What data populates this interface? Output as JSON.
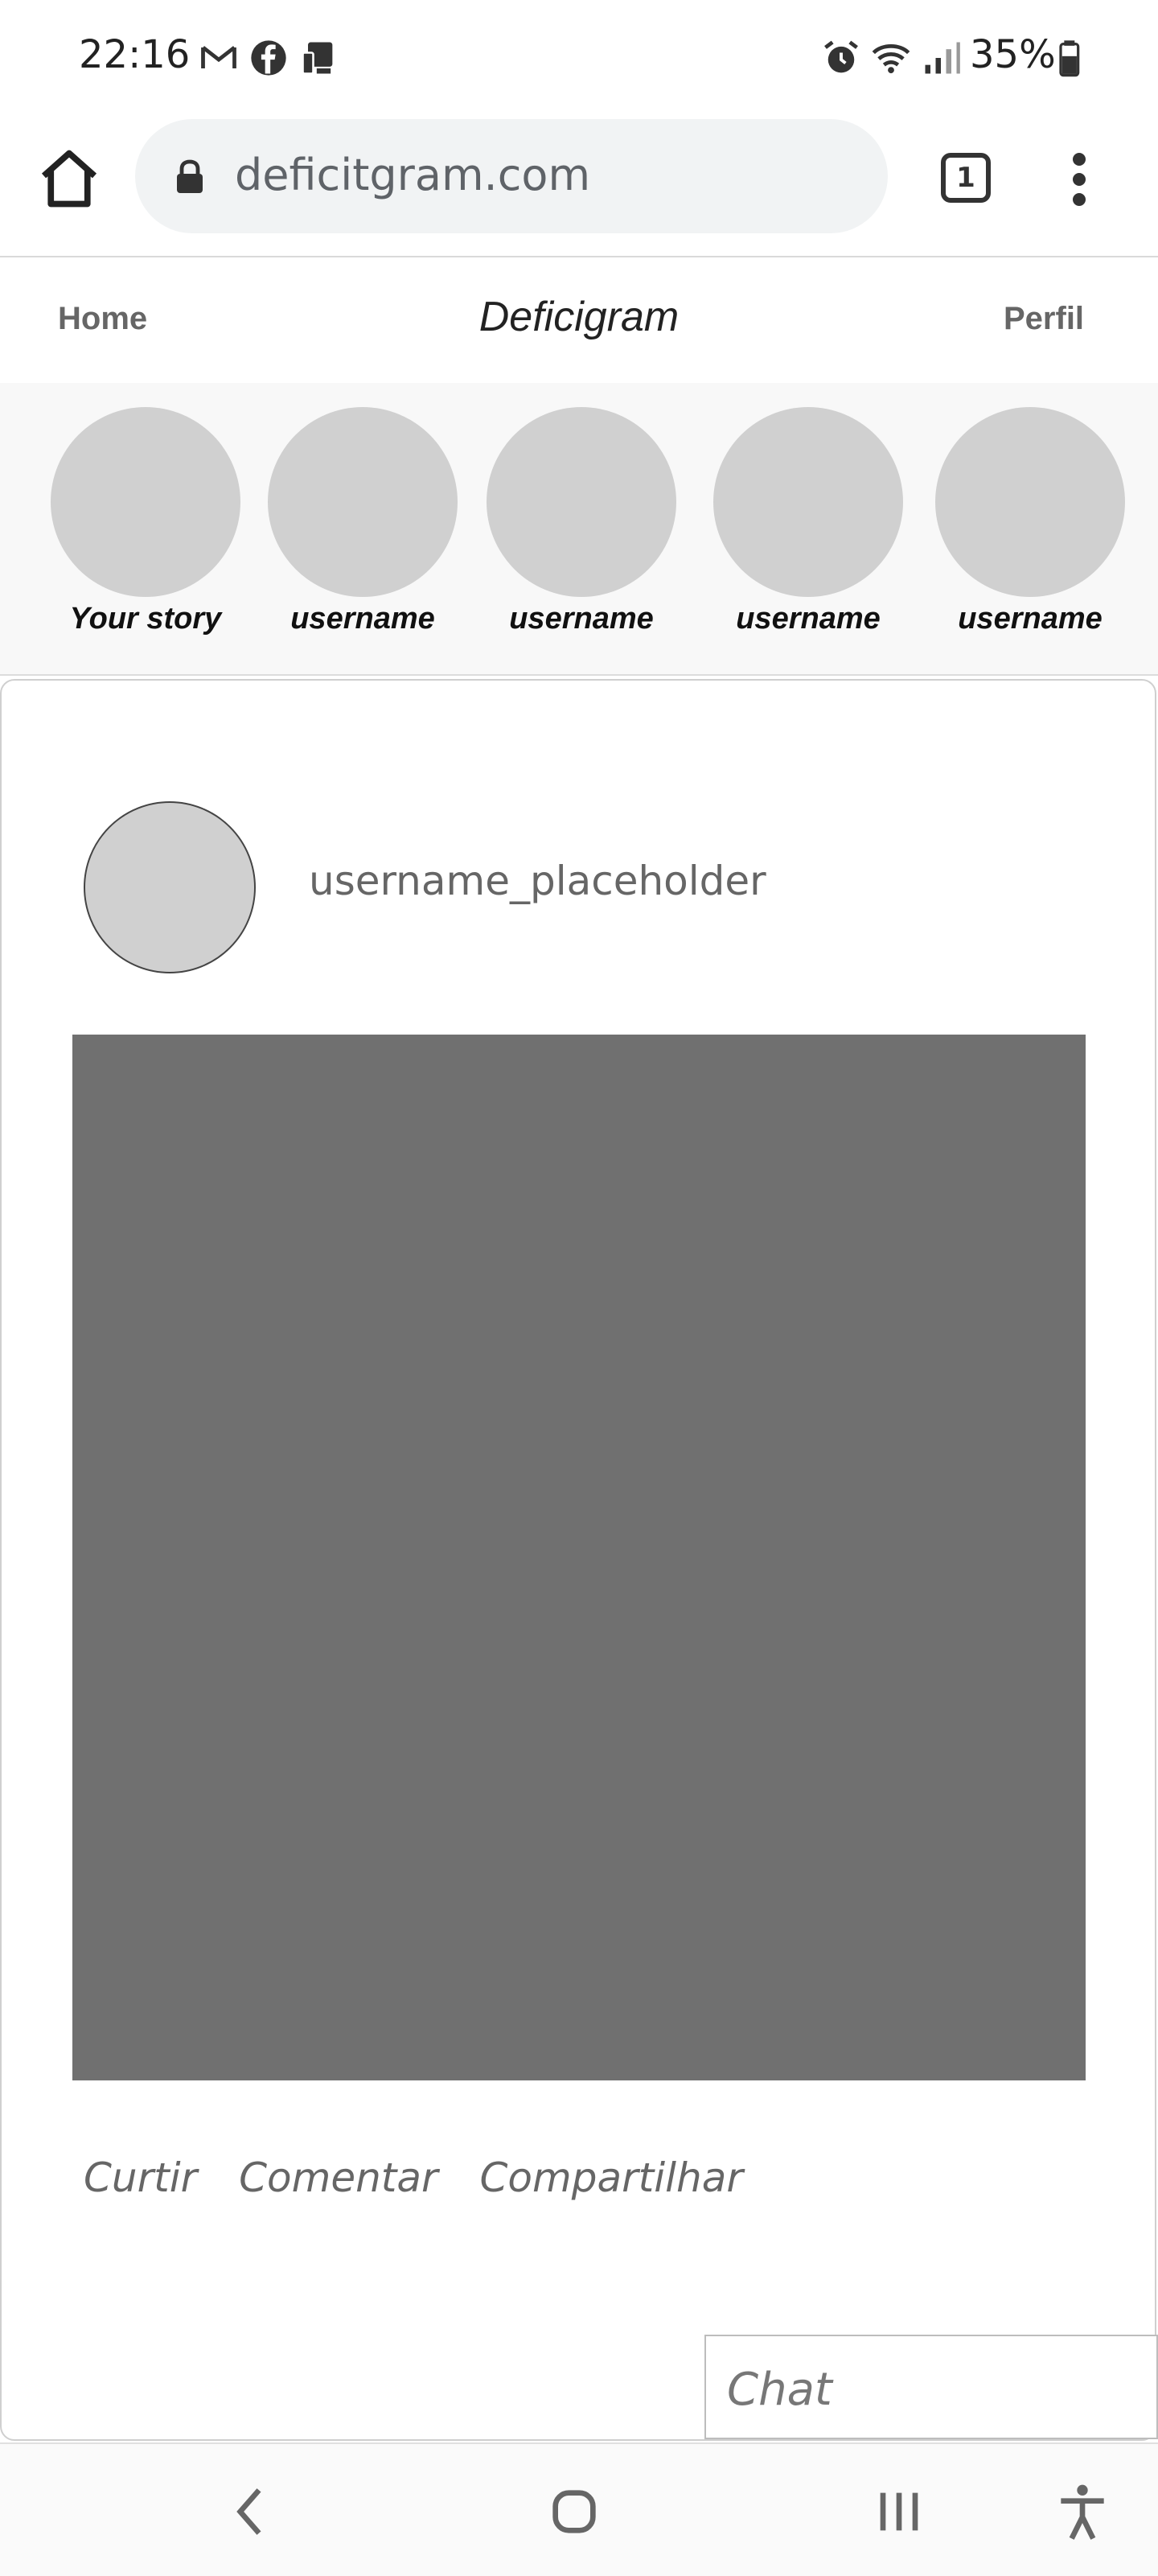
{
  "status_bar": {
    "time": "22:16",
    "notification_icons": [
      "gmail-icon",
      "facebook-icon",
      "device-icon"
    ],
    "system_icons": [
      "alarm-icon",
      "wifi-icon",
      "signal-icon",
      "battery-icon"
    ],
    "battery": "35%"
  },
  "browser": {
    "url": "deficitgram.com",
    "tab_count": "1"
  },
  "site": {
    "nav_home": "Home",
    "title": "Deficigram",
    "nav_profile": "Perfil"
  },
  "stories": [
    {
      "label": "Your story"
    },
    {
      "label": "username"
    },
    {
      "label": "username"
    },
    {
      "label": "username"
    },
    {
      "label": "username"
    }
  ],
  "post": {
    "username": "username_placeholder",
    "actions": {
      "like": "Curtir",
      "comment": "Comentar",
      "share": "Compartilhar"
    }
  },
  "chat": {
    "label": "Chat"
  },
  "colors": {
    "image_placeholder": "#707070",
    "avatar_placeholder": "#d0d0d0",
    "url_bar": "#f1f3f4"
  }
}
